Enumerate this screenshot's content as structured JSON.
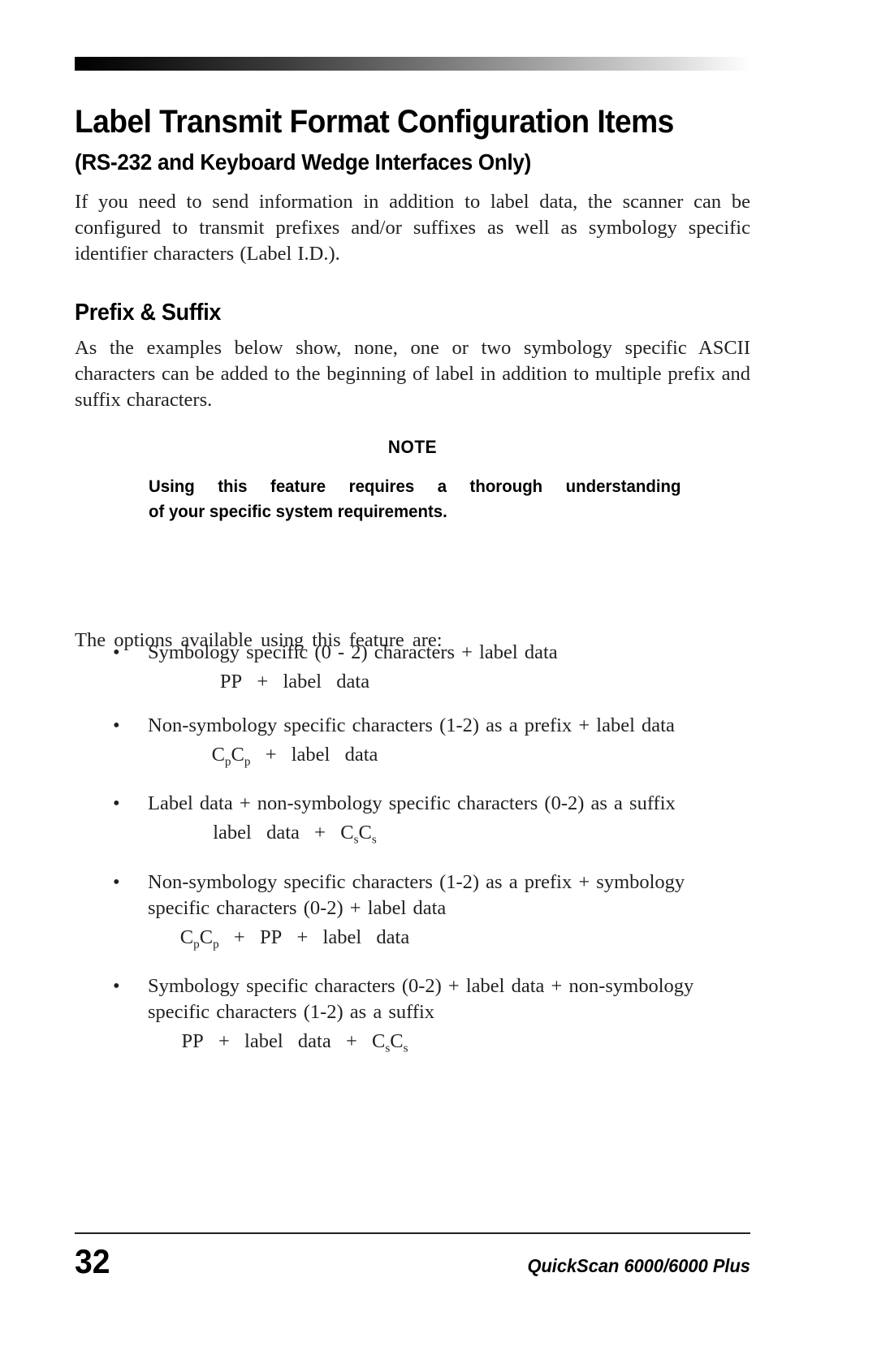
{
  "document": {
    "title": "Label Transmit Format Configuration Items",
    "subtitle": "(RS-232 and Keyboard Wedge Interfaces Only)",
    "intro_paragraph": "If you need to send information in addition to label data, the scanner can be configured to transmit prefixes and/or suffixes as well as symbology specific identifier characters (Label I.D.)."
  },
  "section": {
    "heading": "Prefix & Suffix",
    "body": "As the examples below show, none, one or two symbology specific ASCII characters can be added to the beginning of label in addition to multiple prefix and suffix characters."
  },
  "note": {
    "label": "NOTE",
    "line1": "Using this feature requires a thorough understanding",
    "line2": "of your specific system requirements."
  },
  "options": {
    "lead_in": "The options available using this feature are:",
    "bullet_marker": "•",
    "items": [
      {
        "text": "Symbology specific (0 - 2) characters + label data",
        "formula_plain": "PP + label data",
        "formula_parts": [
          {
            "text": "PP + label data",
            "sub": ""
          }
        ]
      },
      {
        "text": "Non-symbology specific characters (1-2) as a prefix + label data",
        "formula_plain": "CpCp + label data",
        "formula_parts": [
          {
            "text": "C",
            "sub": "p"
          },
          {
            "text": "C",
            "sub": "p"
          },
          {
            "text": " + label data",
            "sub": ""
          }
        ]
      },
      {
        "text": "Label data + non-symbology specific characters (0-2) as a suffix",
        "formula_plain": "label data + CsCs",
        "formula_parts": [
          {
            "text": "label data + ",
            "sub": ""
          },
          {
            "text": "C",
            "sub": "s"
          },
          {
            "text": "C",
            "sub": "s"
          }
        ]
      },
      {
        "text": "Non-symbology specific characters (1-2) as a prefix + symbology specific characters (0-2) + label data",
        "formula_plain": "CpCp + PP + label data",
        "formula_parts": [
          {
            "text": "C",
            "sub": "p"
          },
          {
            "text": "C",
            "sub": "p"
          },
          {
            "text": " + PP + label data",
            "sub": ""
          }
        ]
      },
      {
        "text": "Symbology specific characters (0-2) + label data + non-symbology specific characters (1-2) as a suffix",
        "formula_plain": "PP + label data + CsCs",
        "formula_parts": [
          {
            "text": "PP + label data + ",
            "sub": ""
          },
          {
            "text": "C",
            "sub": "s"
          },
          {
            "text": "C",
            "sub": "s"
          }
        ]
      }
    ]
  },
  "footer": {
    "page_number": "32",
    "product_title": "QuickScan 6000/6000 Plus"
  },
  "colors": {
    "text": "#231f20",
    "heading": "#000000",
    "rule": "#231f20",
    "gradient_start": "#000000",
    "gradient_end": "#ffffff"
  }
}
